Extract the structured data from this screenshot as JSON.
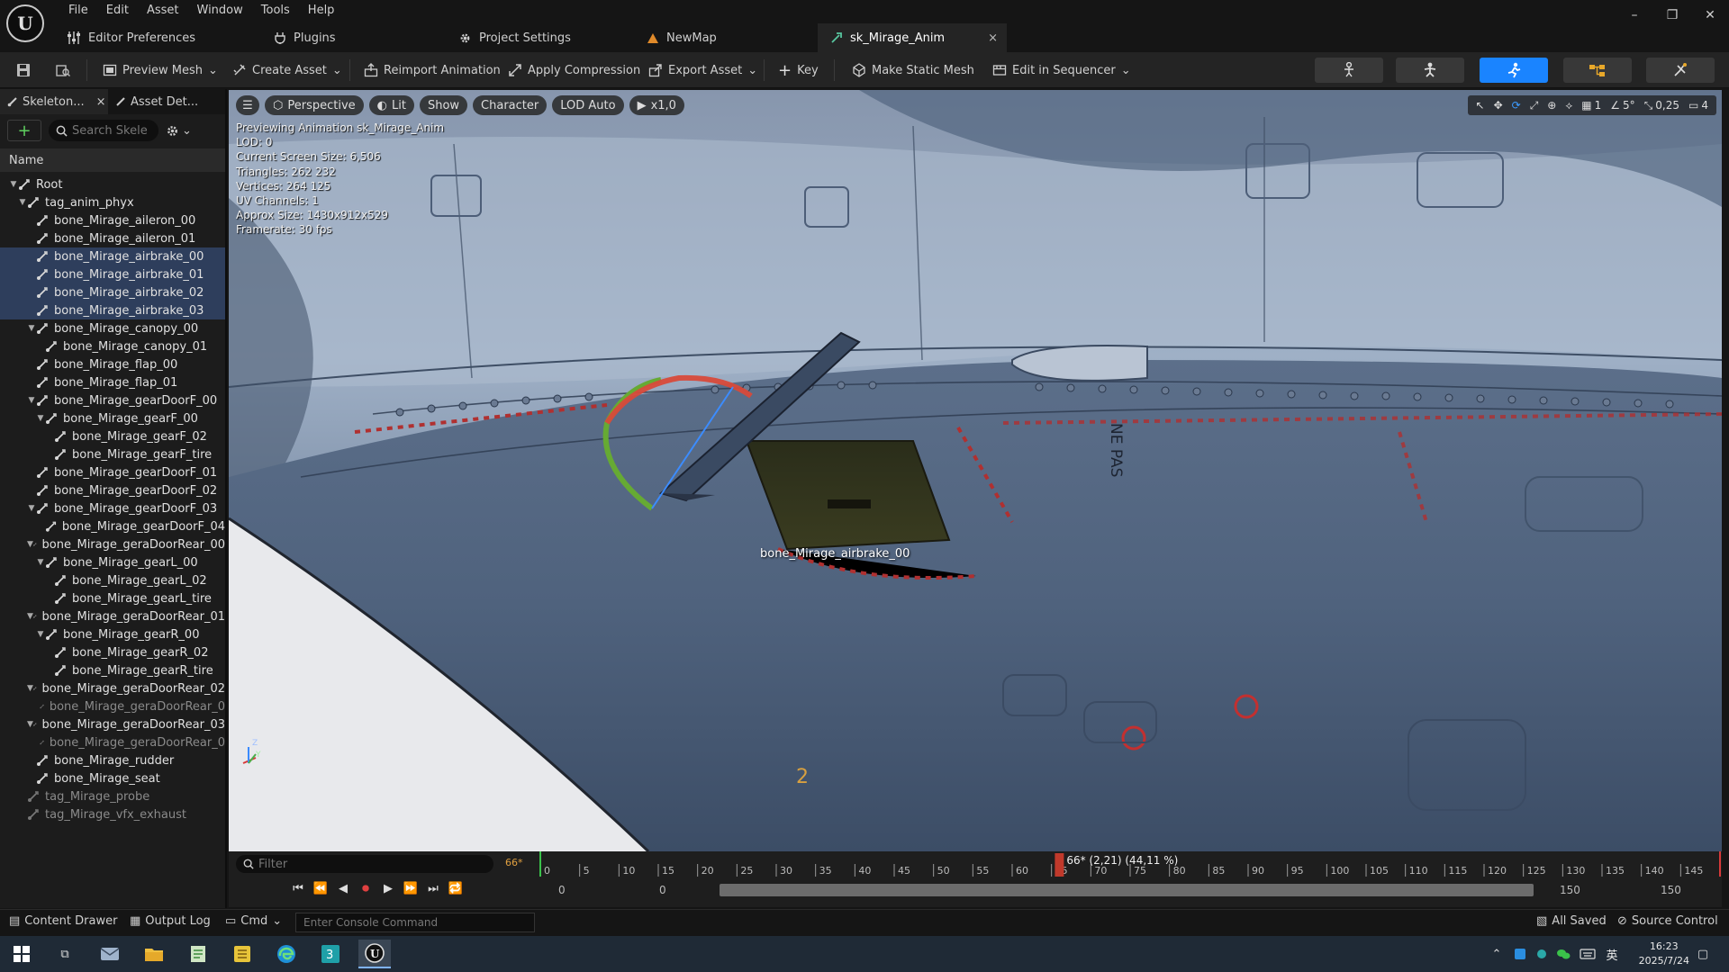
{
  "menu": [
    "File",
    "Edit",
    "Asset",
    "Window",
    "Tools",
    "Help"
  ],
  "window_controls": {
    "minimize": "–",
    "restore": "❐",
    "close": "✕"
  },
  "tabs": [
    {
      "label": "Editor Preferences"
    },
    {
      "label": "Plugins"
    },
    {
      "label": "Project Settings"
    },
    {
      "label": "NewMap"
    },
    {
      "label": "sk_Mirage_Anim",
      "close": "×"
    }
  ],
  "toolbar": {
    "preview_mesh": "Preview Mesh",
    "create_asset": "Create Asset",
    "reimport": "Reimport Animation",
    "apply_compression": "Apply Compression",
    "export_asset": "Export Asset",
    "key": "Key",
    "make_static_mesh": "Make Static Mesh",
    "edit_in_sequencer": "Edit in Sequencer",
    "accent": "#1a84ff"
  },
  "left_panel": {
    "tab_skeleton": "Skeleton...",
    "tab_skeleton_close": "×",
    "tab_asset": "Asset Det...",
    "search_placeholder": "Search Skele",
    "column": "Name",
    "bones": [
      {
        "label": "Root",
        "depth": 0,
        "exp": "▼"
      },
      {
        "label": "tag_anim_phyx",
        "depth": 1,
        "exp": "▼"
      },
      {
        "label": "bone_Mirage_aileron_00",
        "depth": 2
      },
      {
        "label": "bone_Mirage_aileron_01",
        "depth": 2
      },
      {
        "label": "bone_Mirage_airbrake_00",
        "depth": 2,
        "sel": true
      },
      {
        "label": "bone_Mirage_airbrake_01",
        "depth": 2,
        "sel": true
      },
      {
        "label": "bone_Mirage_airbrake_02",
        "depth": 2,
        "sel": true
      },
      {
        "label": "bone_Mirage_airbrake_03",
        "depth": 2,
        "sel": true
      },
      {
        "label": "bone_Mirage_canopy_00",
        "depth": 2,
        "exp": "▼"
      },
      {
        "label": "bone_Mirage_canopy_01",
        "depth": 3
      },
      {
        "label": "bone_Mirage_flap_00",
        "depth": 2
      },
      {
        "label": "bone_Mirage_flap_01",
        "depth": 2
      },
      {
        "label": "bone_Mirage_gearDoorF_00",
        "depth": 2,
        "exp": "▼"
      },
      {
        "label": "bone_Mirage_gearF_00",
        "depth": 3,
        "exp": "▼"
      },
      {
        "label": "bone_Mirage_gearF_02",
        "depth": 4
      },
      {
        "label": "bone_Mirage_gearF_tire",
        "depth": 4
      },
      {
        "label": "bone_Mirage_gearDoorF_01",
        "depth": 2
      },
      {
        "label": "bone_Mirage_gearDoorF_02",
        "depth": 2
      },
      {
        "label": "bone_Mirage_gearDoorF_03",
        "depth": 2,
        "exp": "▼"
      },
      {
        "label": "bone_Mirage_gearDoorF_04",
        "depth": 3
      },
      {
        "label": "bone_Mirage_geraDoorRear_00",
        "depth": 2,
        "exp": "▼"
      },
      {
        "label": "bone_Mirage_gearL_00",
        "depth": 3,
        "exp": "▼"
      },
      {
        "label": "bone_Mirage_gearL_02",
        "depth": 4
      },
      {
        "label": "bone_Mirage_gearL_tire",
        "depth": 4
      },
      {
        "label": "bone_Mirage_geraDoorRear_01",
        "depth": 2,
        "exp": "▼"
      },
      {
        "label": "bone_Mirage_gearR_00",
        "depth": 3,
        "exp": "▼"
      },
      {
        "label": "bone_Mirage_gearR_02",
        "depth": 4
      },
      {
        "label": "bone_Mirage_gearR_tire",
        "depth": 4
      },
      {
        "label": "bone_Mirage_geraDoorRear_02",
        "depth": 2,
        "exp": "▼"
      },
      {
        "label": "bone_Mirage_geraDoorRear_0",
        "depth": 3,
        "dim": true
      },
      {
        "label": "bone_Mirage_geraDoorRear_03",
        "depth": 2,
        "exp": "▼"
      },
      {
        "label": "bone_Mirage_geraDoorRear_0",
        "depth": 3,
        "dim": true
      },
      {
        "label": "bone_Mirage_rudder",
        "depth": 2
      },
      {
        "label": "bone_Mirage_seat",
        "depth": 2
      },
      {
        "label": "tag_Mirage_probe",
        "depth": 1,
        "dim": true
      },
      {
        "label": "tag_Mirage_vfx_exhaust",
        "depth": 1,
        "dim": true
      }
    ]
  },
  "viewport": {
    "perspective": "Perspective",
    "lit": "Lit",
    "show": "Show",
    "character": "Character",
    "lod": "LOD Auto",
    "speed": "x1,0",
    "right_grid": "1",
    "right_angle": "5°",
    "right_scale": "0,25",
    "right_cam": "4",
    "stats": [
      "Previewing Animation sk_Mirage_Anim",
      "LOD: 0",
      "Current Screen Size: 6,506",
      "Triangles: 262 232",
      "Vertices: 264 125",
      "UV Channels: 1",
      "Approx Size: 1430x912x529",
      "Framerate: 30 fps"
    ],
    "bone_label": "bone_Mirage_airbrake_00",
    "fuselage_text": "NE PAS",
    "axis_z": "Z",
    "axis_y": "Y",
    "decal_number": "2"
  },
  "timeline": {
    "filter_placeholder": "Filter",
    "frame_marker": "66*",
    "playhead": "66* (2,21) (44,11 %)",
    "playhead_frame": 66,
    "total_frames": 150,
    "ticks": [
      "0",
      "5",
      "10",
      "15",
      "20",
      "25",
      "30",
      "35",
      "40",
      "45",
      "50",
      "55",
      "60",
      "65",
      "70",
      "75",
      "80",
      "85",
      "90",
      "95",
      "100",
      "105",
      "110",
      "115",
      "120",
      "125",
      "130",
      "135",
      "140",
      "145"
    ],
    "range_start": "0",
    "range_mid": "0",
    "range_end_a": "150",
    "range_end_b": "150"
  },
  "statusbar": {
    "content_drawer": "Content Drawer",
    "output_log": "Output Log",
    "cmd": "Cmd",
    "console_placeholder": "Enter Console Command",
    "saved": "All Saved",
    "source_control": "Source Control"
  },
  "taskbar": {
    "time": "16:23",
    "date": "2025/7/24",
    "ime": "英"
  }
}
